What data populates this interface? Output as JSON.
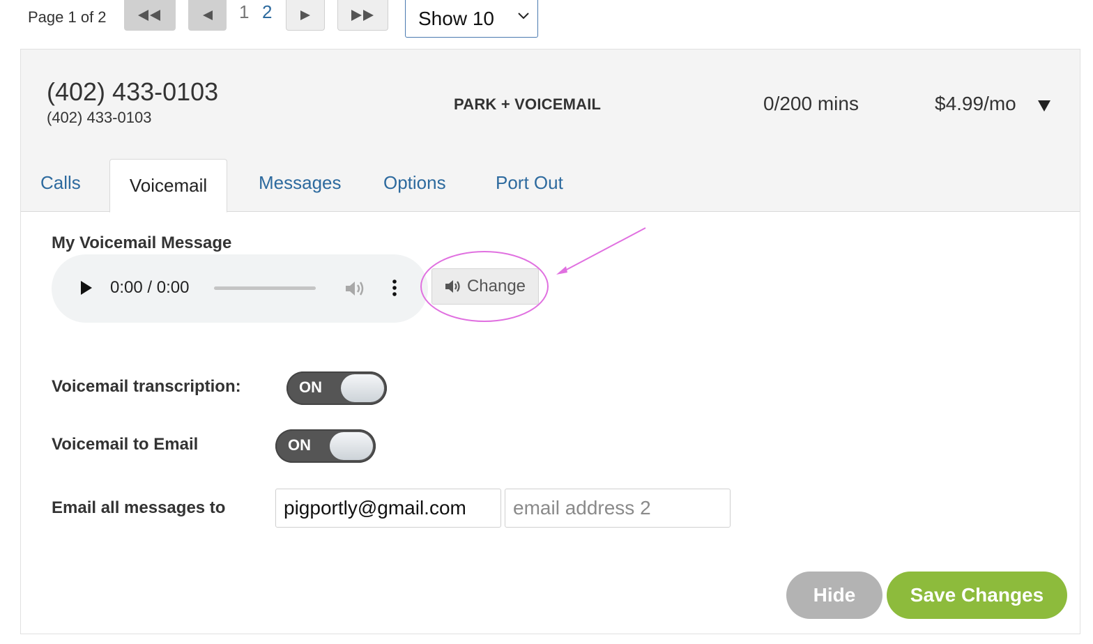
{
  "pagination": {
    "page_label": "Page 1 of 2",
    "pages": [
      "1",
      "2"
    ],
    "first_icon": "double-left-arrow-icon",
    "prev_icon": "left-arrow-icon",
    "next_icon": "right-arrow-icon",
    "last_icon": "double-right-arrow-icon",
    "show_select": "Show 10"
  },
  "line": {
    "number": "(402) 433-0103",
    "number_sub": "(402) 433-0103",
    "plan": "PARK + VOICEMAIL",
    "usage": "0/200 mins",
    "price": "$4.99/mo",
    "expand_icon": "caret-down-icon"
  },
  "tabs": [
    {
      "label": "Calls",
      "active": false
    },
    {
      "label": "Voicemail",
      "active": true
    },
    {
      "label": "Messages",
      "active": false
    },
    {
      "label": "Options",
      "active": false
    },
    {
      "label": "Port Out",
      "active": false
    }
  ],
  "voicemail": {
    "section_title": "My Voicemail Message",
    "audio_time": "0:00 / 0:00",
    "audio_progress": 0,
    "change_label": "Change",
    "change_icon": "speaker-icon",
    "transcription_label": "Voicemail transcription:",
    "transcription_state": "ON",
    "to_email_label": "Voicemail to Email",
    "to_email_state": "ON",
    "email_label": "Email all messages to",
    "email1_value": "pigportly@gmail.com",
    "email2_placeholder": "email address 2"
  },
  "actions": {
    "hide": "Hide",
    "save": "Save Changes"
  },
  "colors": {
    "link": "#2d6a9e",
    "save_green": "#8dbb3c",
    "hide_gray": "#b3b3b3",
    "annotation_magenta": "#e070e0"
  }
}
